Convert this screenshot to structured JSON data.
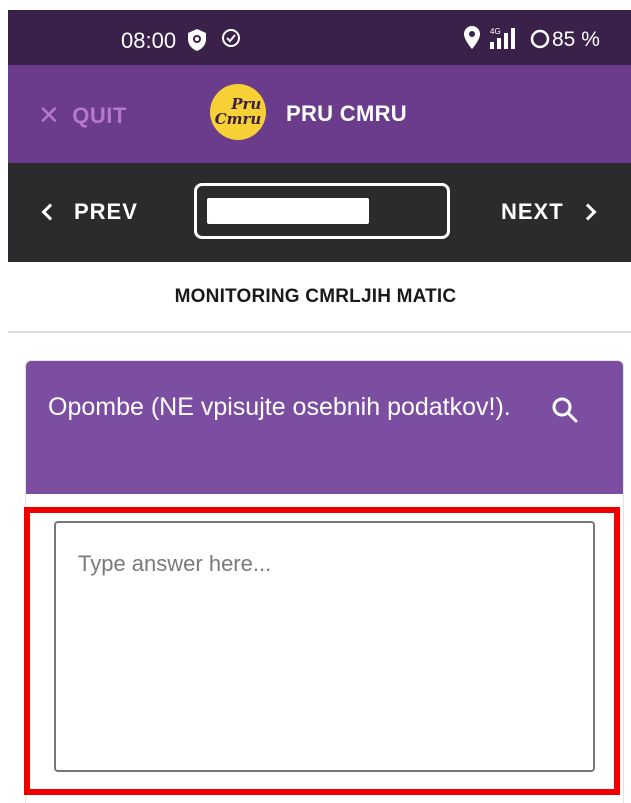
{
  "status_bar": {
    "time": "08:00",
    "network": "4G",
    "battery": "85 %"
  },
  "header": {
    "quit_label": "QUIT",
    "logo_line1": "Pru",
    "logo_line2": "Cmru",
    "title": "PRU CMRU"
  },
  "nav": {
    "prev_label": "PREV",
    "next_label": "NEXT"
  },
  "section": {
    "title": "MONITORING CMRLJIH MATIC"
  },
  "question": {
    "text": "Opombe (NE vpisujte osebnih podatkov!).",
    "answer_placeholder": "Type answer here...",
    "answer_value": ""
  },
  "colors": {
    "status_bar": "#3a2149",
    "header": "#6b3b8c",
    "nav": "#2b2a2c",
    "card_header": "#7b4ea2",
    "highlight": "#ee0000",
    "logo": "#f6d034"
  },
  "icons": [
    "shield-icon",
    "check-circle-icon",
    "location-icon",
    "signal-icon",
    "battery-icon",
    "close-icon",
    "chevron-left-icon",
    "chevron-right-icon",
    "search-icon"
  ]
}
